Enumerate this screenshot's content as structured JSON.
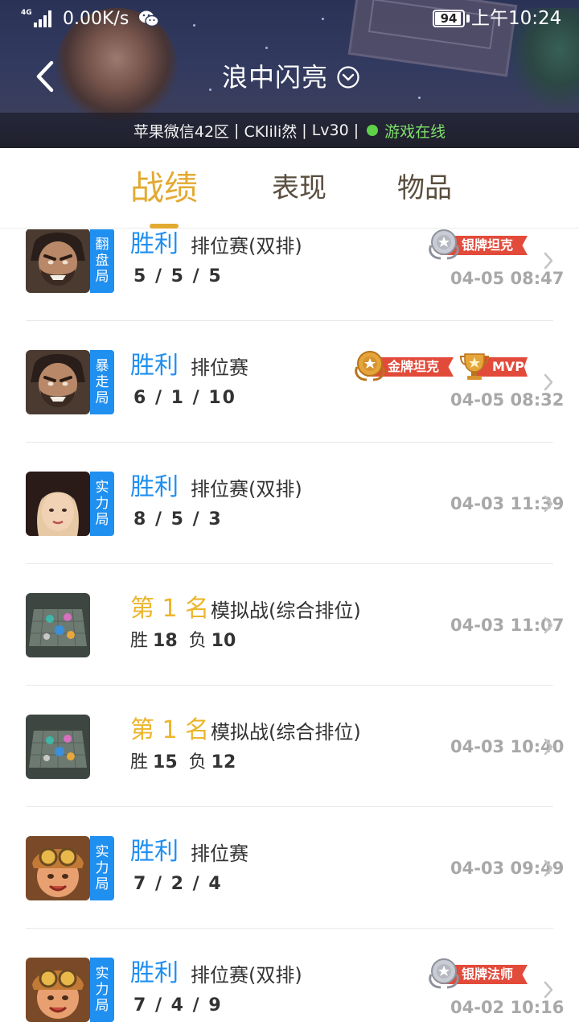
{
  "status_bar": {
    "network": "4G",
    "speed": "0.00K/s",
    "battery": "94",
    "battery_level": 0.94,
    "time": "上午10:24"
  },
  "header": {
    "title": "浪中闪亮",
    "server": "苹果微信42区",
    "player": "CKlili然",
    "level": "Lv30",
    "online_status": "游戏在线",
    "online_color": "#5fd04a"
  },
  "tabs": [
    {
      "label": "战绩",
      "active": true
    },
    {
      "label": "表现",
      "active": false
    },
    {
      "label": "物品",
      "active": false
    }
  ],
  "colors": {
    "accent": "#e3aa32",
    "win": "#1f8ff0",
    "rank": "#ecb52c",
    "badge_red": "#e24a3a"
  },
  "matches": [
    {
      "avatar": "bearded-warrior",
      "mode_tag": [
        "翻",
        "盘",
        "局"
      ],
      "result": "胜利",
      "type": "排位赛(双排)",
      "kda": "5 / 5 / 5",
      "time": "04-05 08:47",
      "badges": [
        {
          "kind": "silver",
          "label": "银牌坦克"
        }
      ]
    },
    {
      "avatar": "bearded-warrior",
      "mode_tag": [
        "暴",
        "走",
        "局"
      ],
      "result": "胜利",
      "type": "排位赛",
      "kda": "6 / 1 / 10",
      "time": "04-05 08:32",
      "badges": [
        {
          "kind": "gold",
          "label": "金牌坦克"
        },
        {
          "kind": "trophy",
          "label": "MVP"
        }
      ]
    },
    {
      "avatar": "dark-hair-girl",
      "mode_tag": [
        "实",
        "力",
        "局"
      ],
      "result": "胜利",
      "type": "排位赛(双排)",
      "kda": "8 / 5 / 3",
      "time": "04-03 11:39",
      "badges": []
    },
    {
      "avatar": "chess-board",
      "result": "第 1 名",
      "type": "模拟战(综合排位)",
      "stats": {
        "win_label": "胜",
        "win": "18",
        "lose_label": "负",
        "lose": "10"
      },
      "time": "04-03 11:07",
      "badges": []
    },
    {
      "avatar": "chess-board",
      "result": "第 1 名",
      "type": "模拟战(综合排位)",
      "stats": {
        "win_label": "胜",
        "win": "15",
        "lose_label": "负",
        "lose": "12"
      },
      "time": "04-03 10:40",
      "badges": []
    },
    {
      "avatar": "goggles-girl",
      "mode_tag": [
        "实",
        "力",
        "局"
      ],
      "result": "胜利",
      "type": "排位赛",
      "kda": "7 / 2 / 4",
      "time": "04-03 09:49",
      "badges": []
    },
    {
      "avatar": "goggles-girl",
      "mode_tag": [
        "实",
        "力",
        "局"
      ],
      "result": "胜利",
      "type": "排位赛(双排)",
      "kda": "7 / 4 / 9",
      "time": "04-02 10:16",
      "badges": [
        {
          "kind": "silver",
          "label": "银牌法师"
        }
      ]
    }
  ]
}
